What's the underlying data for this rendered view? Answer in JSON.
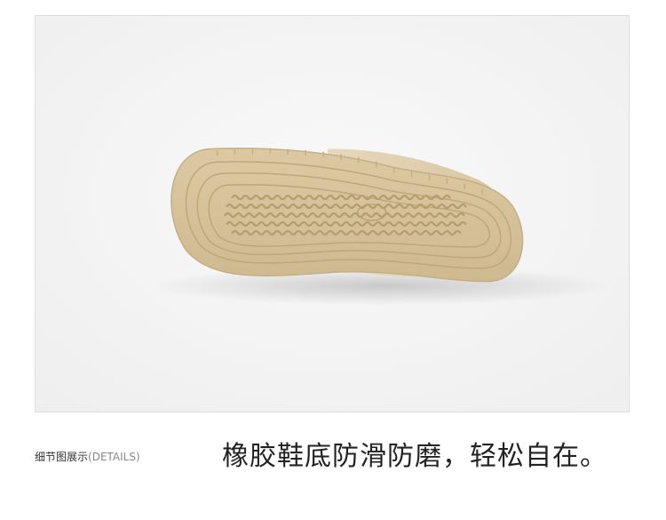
{
  "details_label": {
    "main": "细节图展示",
    "sub": "(DETAILS)"
  },
  "headline": "橡胶鞋底防滑防磨，轻松自在。",
  "colors": {
    "sole": "#d7c39c",
    "sole_dark": "#c2ab80",
    "groove": "#b89f72",
    "background": "#f4f4f4",
    "text_dark": "#222222",
    "text_muted": "#888888"
  }
}
